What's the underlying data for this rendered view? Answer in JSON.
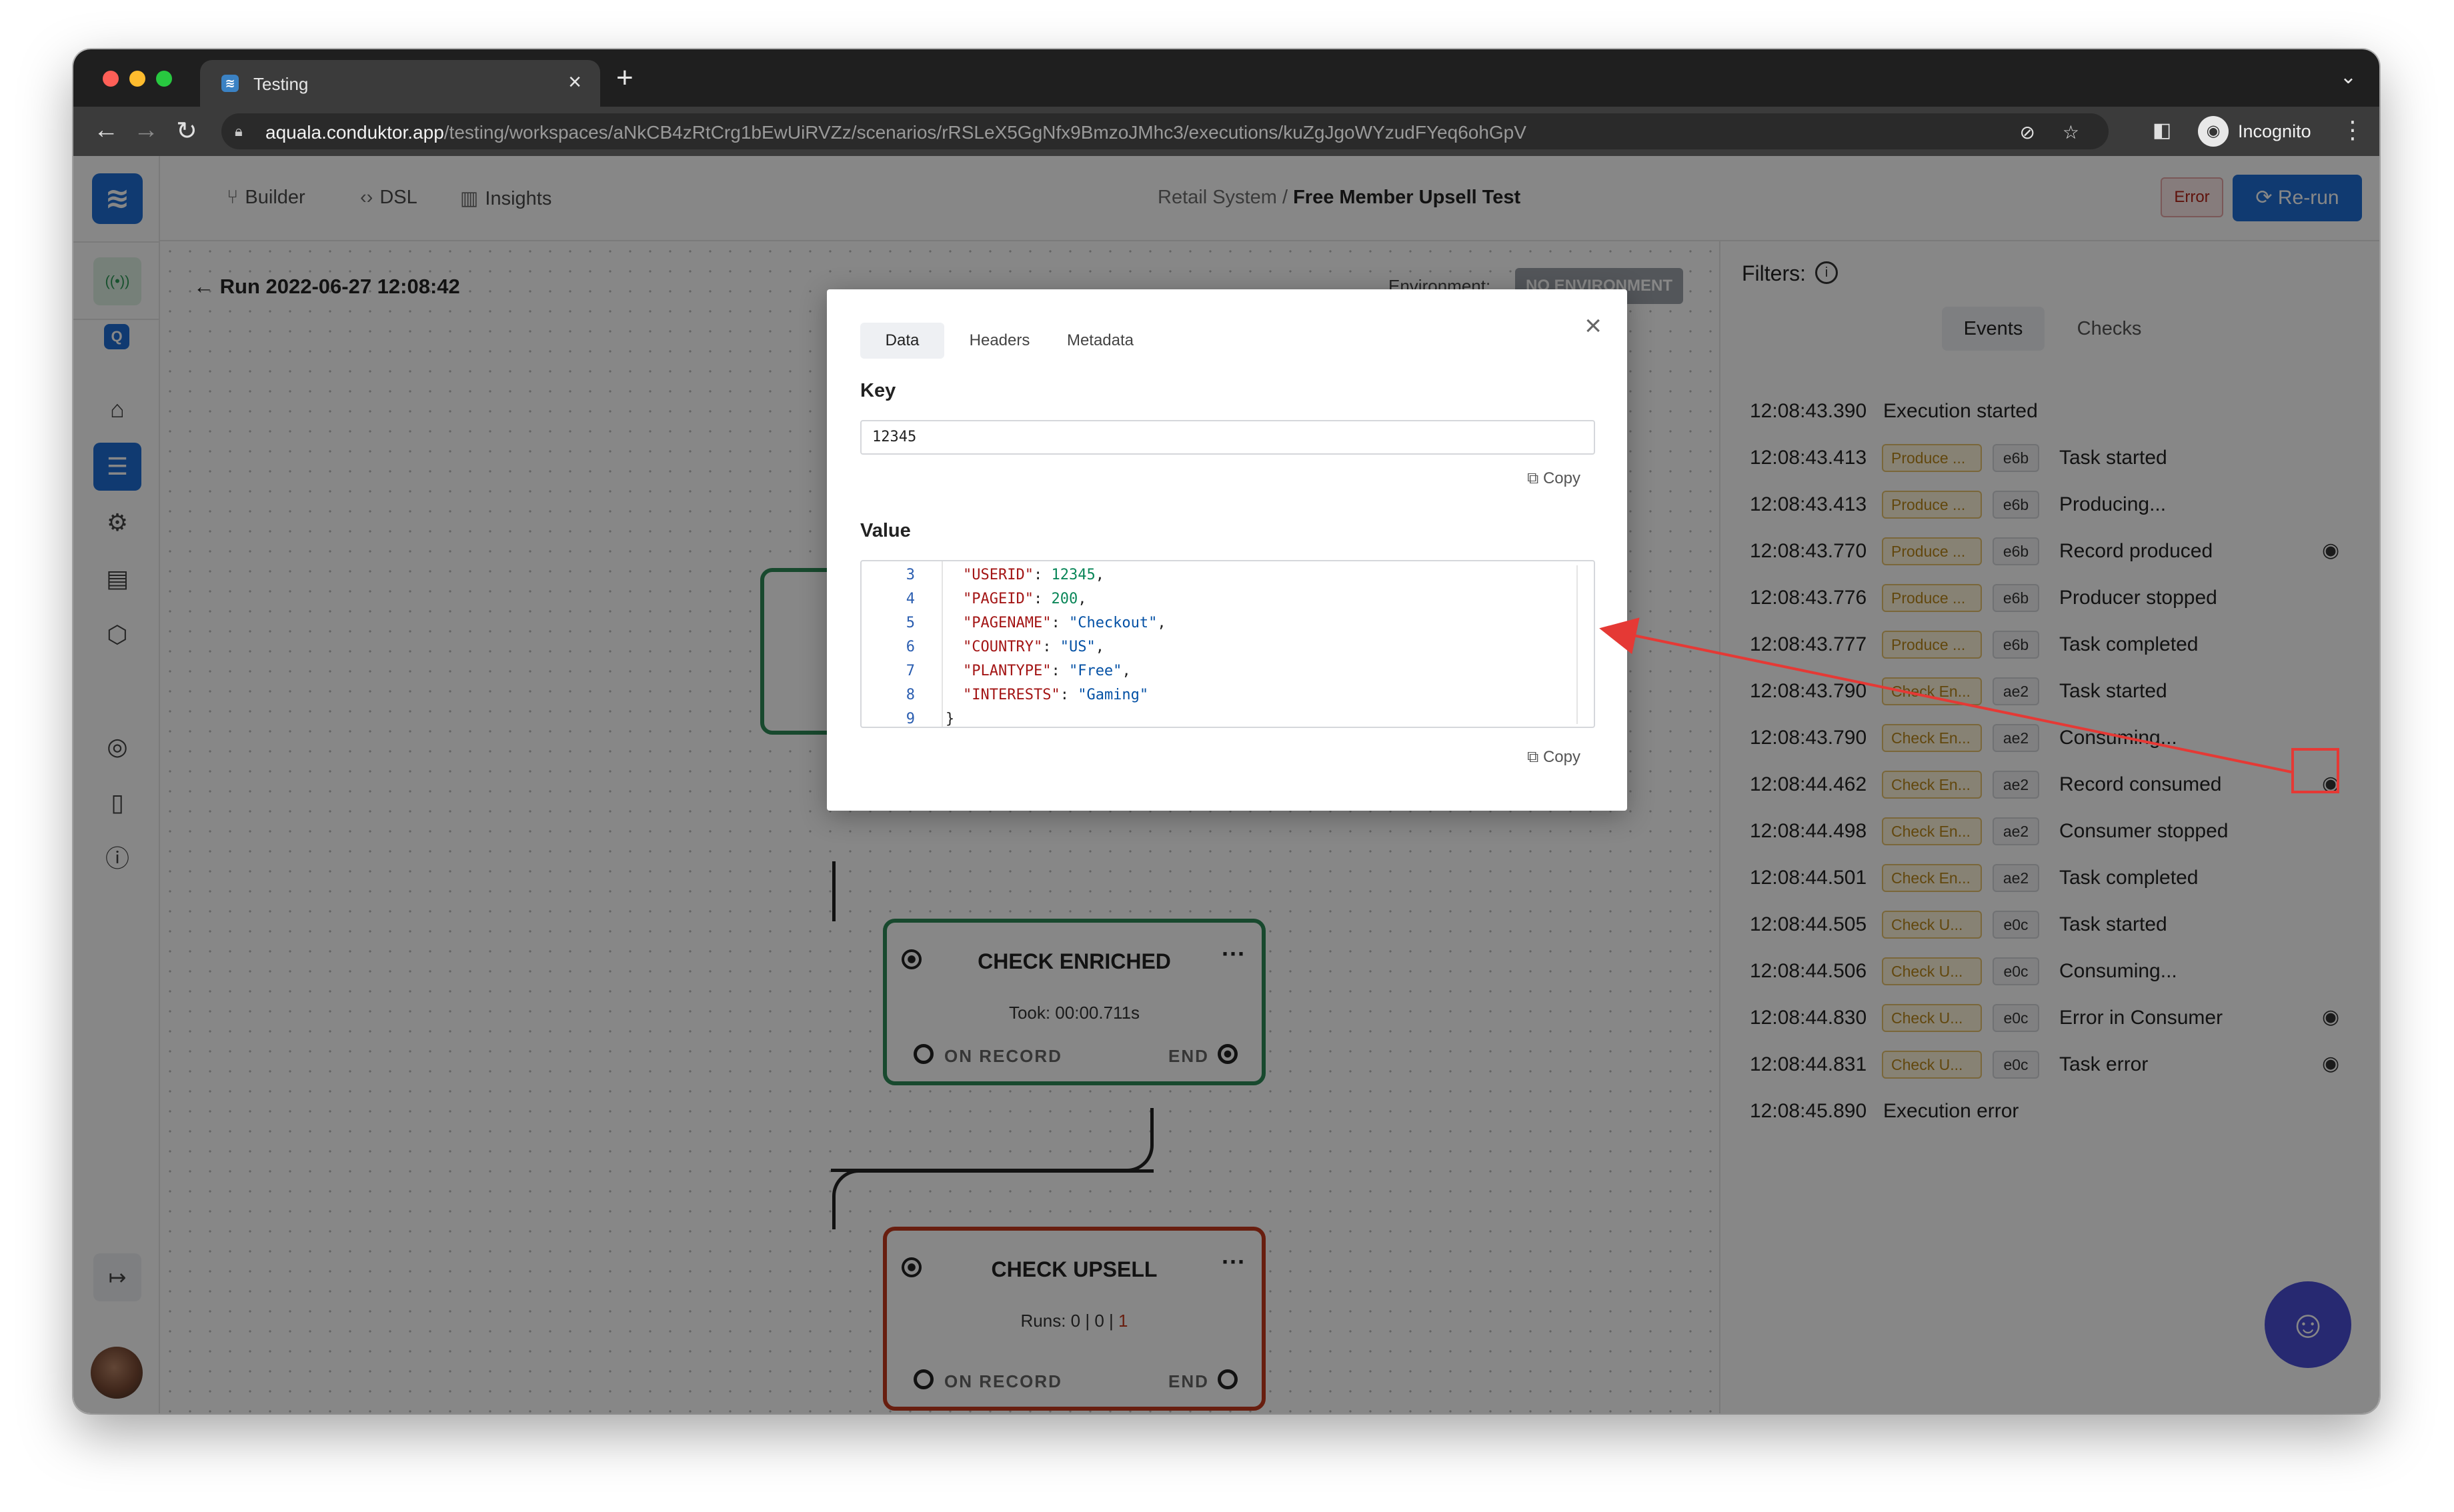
{
  "browser": {
    "tab_title": "Testing",
    "url_host": "aquala.conduktor.app",
    "url_path": "/testing/workspaces/aNkCB4zRtCrg1bEwUiRVZz/scenarios/rRSLeX5GgNfx9BmzoJMhc3/executions/kuZgJgoWYzudFYeq6ohGpV",
    "profile_label": "Incognito"
  },
  "nav": {
    "builder": "Builder",
    "dsl": "DSL",
    "insights": "Insights"
  },
  "breadcrumb": {
    "parent": "Retail System",
    "separator": "/",
    "current": "Free Member Upsell Test"
  },
  "status_badge": "Error",
  "rerun_label": "Re-run",
  "run": {
    "title": "Run 2022-06-27 12:08:42",
    "environment_label": "Environment:",
    "environment_value": "NO ENVIRONMENT"
  },
  "nodes": {
    "check_enriched": {
      "title": "CHECK ENRICHED",
      "took": "Took: 00:00.711s",
      "on_record": "ON RECORD",
      "end": "END"
    },
    "check_upsell": {
      "title": "CHECK UPSELL",
      "runs_prefix": "Runs: 0",
      "runs_mid": "| 0 |",
      "runs_error": "1",
      "on_record": "ON RECORD",
      "end": "END"
    }
  },
  "panel": {
    "filters_label": "Filters:",
    "tab_events": "Events",
    "tab_checks": "Checks",
    "events": [
      {
        "time": "12:08:43.390",
        "tag": "",
        "id": "",
        "text": "Execution started",
        "eye": false
      },
      {
        "time": "12:08:43.413",
        "tag": "Produce ...",
        "id": "e6b",
        "text": "Task started",
        "eye": false
      },
      {
        "time": "12:08:43.413",
        "tag": "Produce ...",
        "id": "e6b",
        "text": "Producing...",
        "eye": false
      },
      {
        "time": "12:08:43.770",
        "tag": "Produce ...",
        "id": "e6b",
        "text": "Record produced",
        "eye": true
      },
      {
        "time": "12:08:43.776",
        "tag": "Produce ...",
        "id": "e6b",
        "text": "Producer stopped",
        "eye": false
      },
      {
        "time": "12:08:43.777",
        "tag": "Produce ...",
        "id": "e6b",
        "text": "Task completed",
        "eye": false
      },
      {
        "time": "12:08:43.790",
        "tag": "Check En...",
        "id": "ae2",
        "text": "Task started",
        "eye": false
      },
      {
        "time": "12:08:43.790",
        "tag": "Check En...",
        "id": "ae2",
        "text": "Consuming...",
        "eye": false
      },
      {
        "time": "12:08:44.462",
        "tag": "Check En...",
        "id": "ae2",
        "text": "Record consumed",
        "eye": true
      },
      {
        "time": "12:08:44.498",
        "tag": "Check En...",
        "id": "ae2",
        "text": "Consumer stopped",
        "eye": false
      },
      {
        "time": "12:08:44.501",
        "tag": "Check En...",
        "id": "ae2",
        "text": "Task completed",
        "eye": false
      },
      {
        "time": "12:08:44.505",
        "tag": "Check U...",
        "id": "e0c",
        "text": "Task started",
        "eye": false
      },
      {
        "time": "12:08:44.506",
        "tag": "Check U...",
        "id": "e0c",
        "text": "Consuming...",
        "eye": false
      },
      {
        "time": "12:08:44.830",
        "tag": "Check U...",
        "id": "e0c",
        "text": "Error in Consumer",
        "eye": true
      },
      {
        "time": "12:08:44.831",
        "tag": "Check U...",
        "id": "e0c",
        "text": "Task error",
        "eye": true
      },
      {
        "time": "12:08:45.890",
        "tag": "",
        "id": "",
        "text": "Execution error",
        "eye": false
      }
    ]
  },
  "modal": {
    "tabs": [
      "Data",
      "Headers",
      "Metadata"
    ],
    "active_tab": "Data",
    "key_label": "Key",
    "key_value": "12345",
    "value_label": "Value",
    "copy_label": "Copy",
    "code_lines": [
      {
        "ln": "3",
        "key": "\"USERID\"",
        "val": "12345",
        "val_type": "number",
        "trail": ","
      },
      {
        "ln": "4",
        "key": "\"PAGEID\"",
        "val": "200",
        "val_type": "number",
        "trail": ","
      },
      {
        "ln": "5",
        "key": "\"PAGENAME\"",
        "val": "\"Checkout\"",
        "val_type": "string",
        "trail": ","
      },
      {
        "ln": "6",
        "key": "\"COUNTRY\"",
        "val": "\"US\"",
        "val_type": "string",
        "trail": ","
      },
      {
        "ln": "7",
        "key": "\"PLANTYPE\"",
        "val": "\"Free\"",
        "val_type": "string",
        "trail": ","
      },
      {
        "ln": "8",
        "key": "\"INTERESTS\"",
        "val": "\"Gaming\"",
        "val_type": "string",
        "trail": ""
      },
      {
        "ln": "9",
        "key": "",
        "val": "}",
        "val_type": "brace",
        "trail": ""
      }
    ]
  },
  "colors": {
    "primary": "#1f6fd6",
    "success_border": "#2e8b57",
    "error_border": "#c53a1e",
    "annotation_red": "#e53935",
    "tag_yellow": "#b9861a"
  }
}
